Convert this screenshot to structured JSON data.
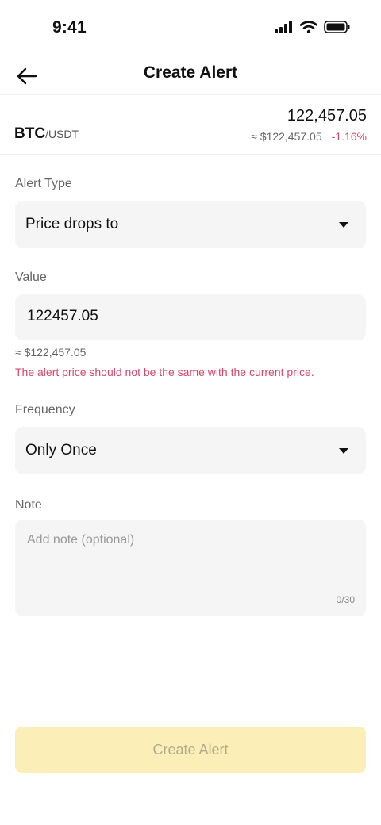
{
  "status": {
    "time": "9:41"
  },
  "header": {
    "title": "Create Alert"
  },
  "ticker": {
    "base": "BTC",
    "quote": "/USDT",
    "last_price": "122,457.05",
    "fiat_price": "≈ $122,457.05",
    "change": "-1.16%"
  },
  "alert_type": {
    "label": "Alert Type",
    "value": "Price drops to"
  },
  "value_field": {
    "label": "Value",
    "value": "122457.05",
    "fiat_hint": "≈ $122,457.05",
    "error": "The alert price should not be the same with the current price."
  },
  "frequency": {
    "label": "Frequency",
    "value": "Only Once"
  },
  "note": {
    "label": "Note",
    "placeholder": "Add note (optional)",
    "counter": "0/30"
  },
  "submit": {
    "label": "Create Alert"
  },
  "colors": {
    "negative": "#d9466b",
    "button_disabled": "#fbefb7"
  }
}
